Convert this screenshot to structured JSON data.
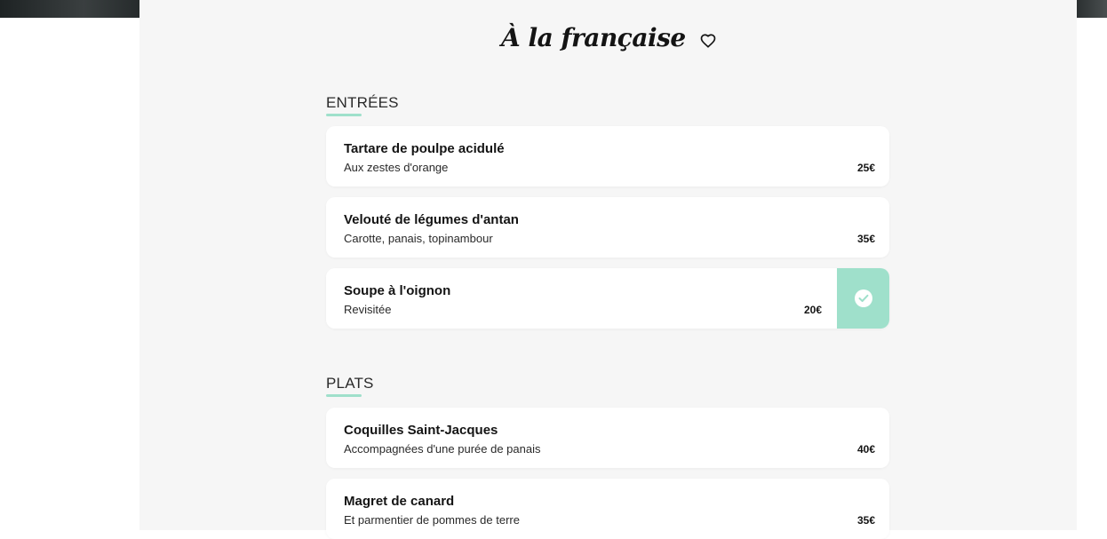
{
  "app": {
    "title": "À la française",
    "icons": {
      "favorite": "heart-icon",
      "selected": "check-circle-icon"
    },
    "colors": {
      "accent": "#9fe0cb",
      "panel_bg": "#f6f6f6",
      "card_bg": "#ffffff",
      "text": "#141414"
    }
  },
  "sections": [
    {
      "title": "ENTRÉES",
      "items": [
        {
          "name": "Tartare de poulpe acidulé",
          "description": "Aux zestes d'orange",
          "price": "25€",
          "selected": false
        },
        {
          "name": "Velouté de légumes d'antan",
          "description": "Carotte, panais, topinambour",
          "price": "35€",
          "selected": false
        },
        {
          "name": "Soupe à l'oignon",
          "description": "Revisitée",
          "price": "20€",
          "selected": true
        }
      ]
    },
    {
      "title": "PLATS",
      "items": [
        {
          "name": "Coquilles Saint-Jacques",
          "description": "Accompagnées d'une purée de panais",
          "price": "40€",
          "selected": false
        },
        {
          "name": "Magret de canard",
          "description": "Et parmentier de pommes de terre",
          "price": "35€",
          "selected": false
        }
      ]
    }
  ]
}
